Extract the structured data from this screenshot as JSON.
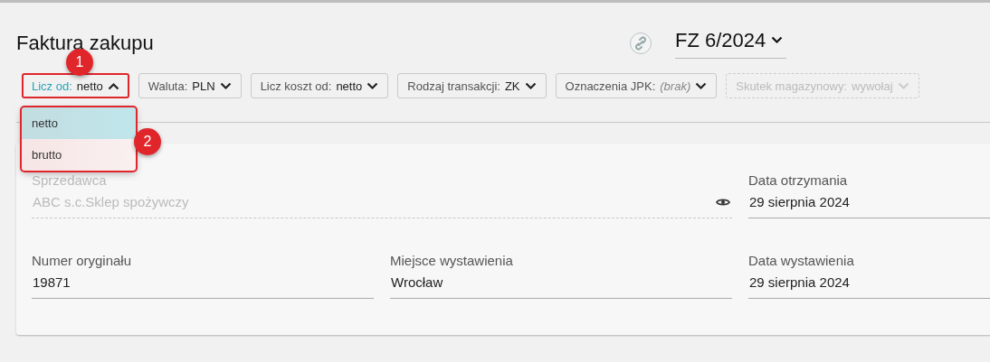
{
  "title": "Faktura zakupu",
  "link_button": {
    "kind": "link"
  },
  "document_number": "FZ 6/2024",
  "filters": [
    {
      "label": "Licz od:",
      "value": "netto",
      "open": true,
      "disabled": false,
      "empty": false,
      "highlighted": true
    },
    {
      "label": "Waluta:",
      "value": "PLN",
      "open": false,
      "disabled": false,
      "empty": false,
      "highlighted": false
    },
    {
      "label": "Licz koszt od:",
      "value": "netto",
      "open": false,
      "disabled": false,
      "empty": false,
      "highlighted": false
    },
    {
      "label": "Rodzaj transakcji:",
      "value": "ZK",
      "open": false,
      "disabled": false,
      "empty": false,
      "highlighted": false
    },
    {
      "label": "Oznaczenia JPK:",
      "value": "(brak)",
      "open": false,
      "disabled": false,
      "empty": true,
      "highlighted": false
    },
    {
      "label": "Skutek magazynowy:",
      "value": "wywołaj",
      "open": false,
      "disabled": true,
      "empty": false,
      "highlighted": false
    }
  ],
  "dropdown": {
    "highlighted": true,
    "options": [
      {
        "label": "netto",
        "selected": true
      },
      {
        "label": "brutto",
        "selected": false
      }
    ]
  },
  "annotations": [
    {
      "label": "1"
    },
    {
      "label": "2"
    }
  ],
  "fields": [
    {
      "kind": "wide",
      "label": "Sprzedawca",
      "value": "ABC s.c.Sklep spożywczy",
      "disabled": true
    },
    {
      "kind": "normal",
      "label": "Data otrzymania",
      "value": "29 sierpnia 2024",
      "disabled": false
    },
    {
      "kind": "normal",
      "label": "Numer oryginału",
      "value": "19871",
      "disabled": false
    },
    {
      "kind": "normal",
      "label": "Miejsce wystawienia",
      "value": "Wrocław",
      "disabled": false
    },
    {
      "kind": "normal",
      "label": "Data wystawienia",
      "value": "29 sierpnia 2024",
      "disabled": false
    }
  ]
}
